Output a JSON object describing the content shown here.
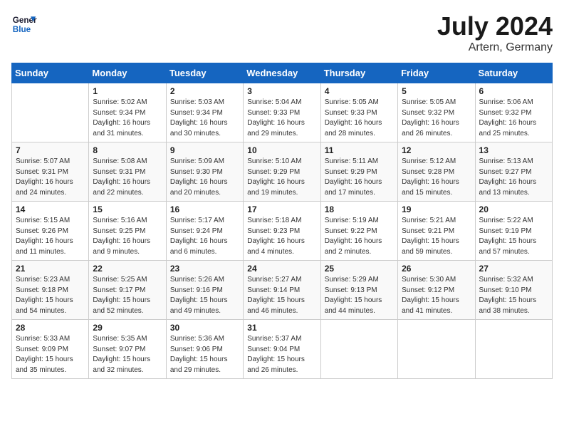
{
  "header": {
    "logo_line1": "General",
    "logo_line2": "Blue",
    "month": "July 2024",
    "location": "Artern, Germany"
  },
  "columns": [
    "Sunday",
    "Monday",
    "Tuesday",
    "Wednesday",
    "Thursday",
    "Friday",
    "Saturday"
  ],
  "weeks": [
    [
      {
        "day": "",
        "info": ""
      },
      {
        "day": "1",
        "info": "Sunrise: 5:02 AM\nSunset: 9:34 PM\nDaylight: 16 hours\nand 31 minutes."
      },
      {
        "day": "2",
        "info": "Sunrise: 5:03 AM\nSunset: 9:34 PM\nDaylight: 16 hours\nand 30 minutes."
      },
      {
        "day": "3",
        "info": "Sunrise: 5:04 AM\nSunset: 9:33 PM\nDaylight: 16 hours\nand 29 minutes."
      },
      {
        "day": "4",
        "info": "Sunrise: 5:05 AM\nSunset: 9:33 PM\nDaylight: 16 hours\nand 28 minutes."
      },
      {
        "day": "5",
        "info": "Sunrise: 5:05 AM\nSunset: 9:32 PM\nDaylight: 16 hours\nand 26 minutes."
      },
      {
        "day": "6",
        "info": "Sunrise: 5:06 AM\nSunset: 9:32 PM\nDaylight: 16 hours\nand 25 minutes."
      }
    ],
    [
      {
        "day": "7",
        "info": "Sunrise: 5:07 AM\nSunset: 9:31 PM\nDaylight: 16 hours\nand 24 minutes."
      },
      {
        "day": "8",
        "info": "Sunrise: 5:08 AM\nSunset: 9:31 PM\nDaylight: 16 hours\nand 22 minutes."
      },
      {
        "day": "9",
        "info": "Sunrise: 5:09 AM\nSunset: 9:30 PM\nDaylight: 16 hours\nand 20 minutes."
      },
      {
        "day": "10",
        "info": "Sunrise: 5:10 AM\nSunset: 9:29 PM\nDaylight: 16 hours\nand 19 minutes."
      },
      {
        "day": "11",
        "info": "Sunrise: 5:11 AM\nSunset: 9:29 PM\nDaylight: 16 hours\nand 17 minutes."
      },
      {
        "day": "12",
        "info": "Sunrise: 5:12 AM\nSunset: 9:28 PM\nDaylight: 16 hours\nand 15 minutes."
      },
      {
        "day": "13",
        "info": "Sunrise: 5:13 AM\nSunset: 9:27 PM\nDaylight: 16 hours\nand 13 minutes."
      }
    ],
    [
      {
        "day": "14",
        "info": "Sunrise: 5:15 AM\nSunset: 9:26 PM\nDaylight: 16 hours\nand 11 minutes."
      },
      {
        "day": "15",
        "info": "Sunrise: 5:16 AM\nSunset: 9:25 PM\nDaylight: 16 hours\nand 9 minutes."
      },
      {
        "day": "16",
        "info": "Sunrise: 5:17 AM\nSunset: 9:24 PM\nDaylight: 16 hours\nand 6 minutes."
      },
      {
        "day": "17",
        "info": "Sunrise: 5:18 AM\nSunset: 9:23 PM\nDaylight: 16 hours\nand 4 minutes."
      },
      {
        "day": "18",
        "info": "Sunrise: 5:19 AM\nSunset: 9:22 PM\nDaylight: 16 hours\nand 2 minutes."
      },
      {
        "day": "19",
        "info": "Sunrise: 5:21 AM\nSunset: 9:21 PM\nDaylight: 15 hours\nand 59 minutes."
      },
      {
        "day": "20",
        "info": "Sunrise: 5:22 AM\nSunset: 9:19 PM\nDaylight: 15 hours\nand 57 minutes."
      }
    ],
    [
      {
        "day": "21",
        "info": "Sunrise: 5:23 AM\nSunset: 9:18 PM\nDaylight: 15 hours\nand 54 minutes."
      },
      {
        "day": "22",
        "info": "Sunrise: 5:25 AM\nSunset: 9:17 PM\nDaylight: 15 hours\nand 52 minutes."
      },
      {
        "day": "23",
        "info": "Sunrise: 5:26 AM\nSunset: 9:16 PM\nDaylight: 15 hours\nand 49 minutes."
      },
      {
        "day": "24",
        "info": "Sunrise: 5:27 AM\nSunset: 9:14 PM\nDaylight: 15 hours\nand 46 minutes."
      },
      {
        "day": "25",
        "info": "Sunrise: 5:29 AM\nSunset: 9:13 PM\nDaylight: 15 hours\nand 44 minutes."
      },
      {
        "day": "26",
        "info": "Sunrise: 5:30 AM\nSunset: 9:12 PM\nDaylight: 15 hours\nand 41 minutes."
      },
      {
        "day": "27",
        "info": "Sunrise: 5:32 AM\nSunset: 9:10 PM\nDaylight: 15 hours\nand 38 minutes."
      }
    ],
    [
      {
        "day": "28",
        "info": "Sunrise: 5:33 AM\nSunset: 9:09 PM\nDaylight: 15 hours\nand 35 minutes."
      },
      {
        "day": "29",
        "info": "Sunrise: 5:35 AM\nSunset: 9:07 PM\nDaylight: 15 hours\nand 32 minutes."
      },
      {
        "day": "30",
        "info": "Sunrise: 5:36 AM\nSunset: 9:06 PM\nDaylight: 15 hours\nand 29 minutes."
      },
      {
        "day": "31",
        "info": "Sunrise: 5:37 AM\nSunset: 9:04 PM\nDaylight: 15 hours\nand 26 minutes."
      },
      {
        "day": "",
        "info": ""
      },
      {
        "day": "",
        "info": ""
      },
      {
        "day": "",
        "info": ""
      }
    ]
  ]
}
